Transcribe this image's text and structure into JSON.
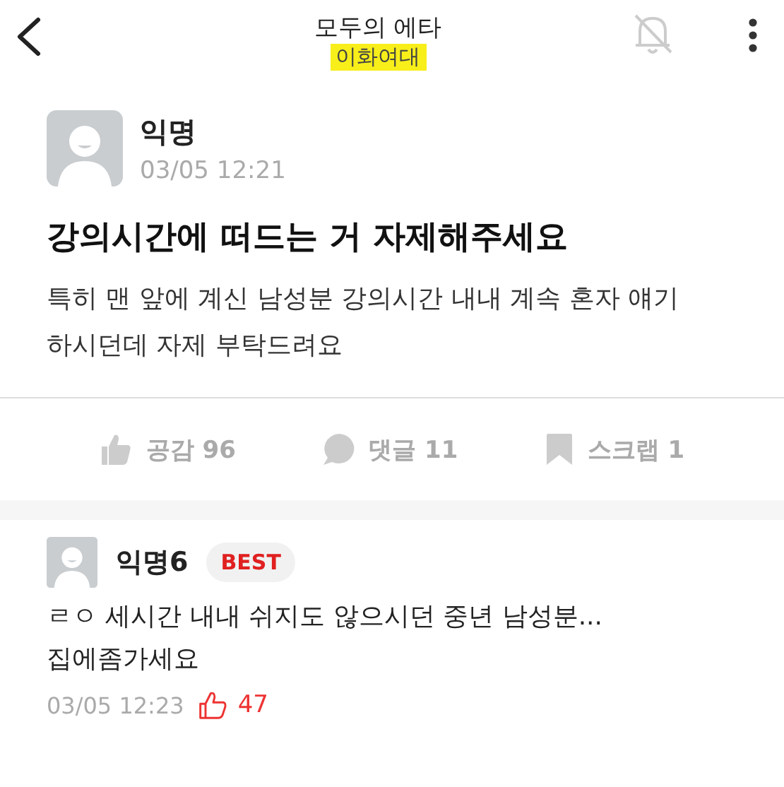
{
  "header": {
    "title": "모두의 에타",
    "subtitle": "이화여대",
    "subtitle_highlighted": true,
    "notifications_muted": true
  },
  "post": {
    "author": "익명",
    "time": "03/05 12:21",
    "title": "강의시간에 떠드는 거 자제해주세요",
    "body": "특히 맨 앞에 계신 남성분 강의시간 내내 계속 혼자 얘기하시던데 자제 부탁드려요",
    "actions": [
      {
        "kind": "like",
        "label": "공감 96"
      },
      {
        "kind": "comment",
        "label": "댓글 11"
      },
      {
        "kind": "scrap",
        "label": "스크랩 1"
      }
    ]
  },
  "comments": [
    {
      "author": "익명6",
      "badge": "BEST",
      "text": "ㄹㅇ 세시간 내내 쉬지도 않으시던 중년 남성분...\n집에좀가세요",
      "time": "03/05 12:23",
      "likes": "47"
    }
  ]
}
